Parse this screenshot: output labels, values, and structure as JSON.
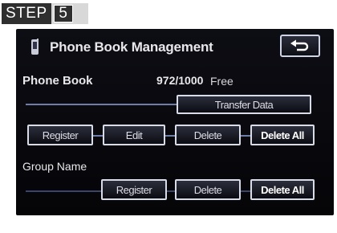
{
  "step": {
    "label": "STEP",
    "number": "5"
  },
  "header": {
    "title": "Phone Book Management",
    "back_icon": "return-arrow-icon"
  },
  "phone_book": {
    "label": "Phone Book",
    "count": "972/1000",
    "free": "Free",
    "transfer_label": "Transfer Data",
    "register_label": "Register",
    "edit_label": "Edit",
    "delete_label": "Delete",
    "delete_all_label": "Delete All"
  },
  "group_name": {
    "label": "Group Name",
    "register_label": "Register",
    "delete_label": "Delete",
    "delete_all_label": "Delete All"
  },
  "colors": {
    "accent_border": "#d8dbe8",
    "connector": "#6f7ea8"
  }
}
